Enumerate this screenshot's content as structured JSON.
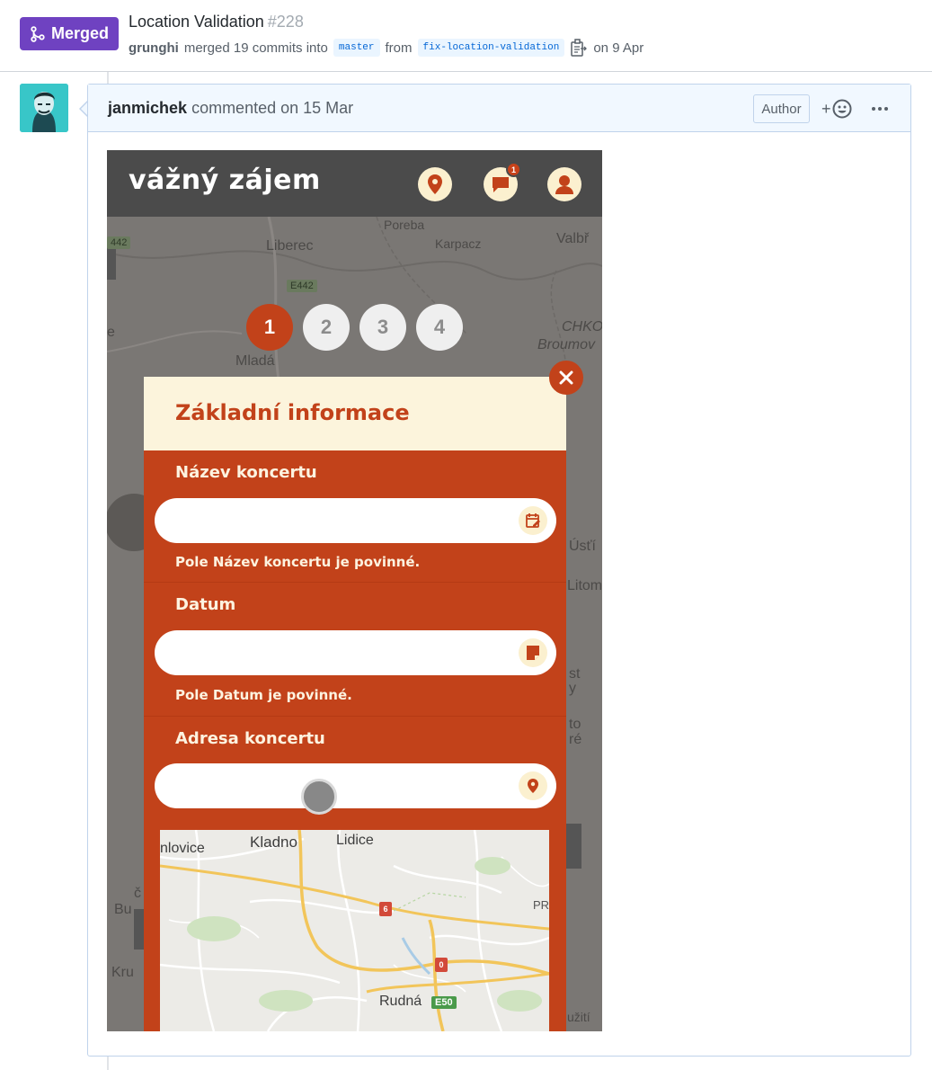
{
  "pr": {
    "status_label": "Merged",
    "title": "Location Validation",
    "number": "#228",
    "merger": "grunghi",
    "merge_text": "merged 19 commits into",
    "base_branch": "master",
    "from_text": "from",
    "head_branch": "fix-location-validation",
    "date_text": "on 9 Apr"
  },
  "comment": {
    "author": "janmichek",
    "action_text": "commented on 15 Mar",
    "author_label": "Author",
    "reaction_label": "+"
  },
  "app": {
    "logo": "vážný zájem",
    "notification_count": "1",
    "steps": [
      "1",
      "2",
      "3",
      "4"
    ],
    "active_step": 1,
    "map_labels": [
      "Poreba",
      "Liberec",
      "Karpacz",
      "Valbř",
      "E442",
      "E442",
      "Mladá",
      "CHKO",
      "Broumov",
      "Úsťí",
      "Litom",
      "st",
      "y",
      "to",
      "ré",
      "č",
      "Bu",
      "Kru",
      "e",
      "užití",
      "442"
    ],
    "colors": {
      "accent": "#c2421a",
      "cream": "#fcf4dc",
      "topbar": "#4b4b4b",
      "merged": "#6f42c1"
    },
    "modal": {
      "title": "Základní informace",
      "fields": [
        {
          "label": "Název koncertu",
          "value": "",
          "error": "Pole Název koncertu je povinné.",
          "icon": "calendar-edit-icon"
        },
        {
          "label": "Datum",
          "value": "",
          "error": "Pole Datum je povinné.",
          "icon": "note-icon"
        },
        {
          "label": "Adresa koncertu",
          "value": "",
          "icon": "location-pin-icon"
        }
      ]
    },
    "minimap": {
      "labels": [
        "Kladno",
        "Lidice",
        "nlovice",
        "Rudná",
        "PRA"
      ],
      "badges": [
        "6",
        "0"
      ],
      "road": "E50"
    }
  }
}
